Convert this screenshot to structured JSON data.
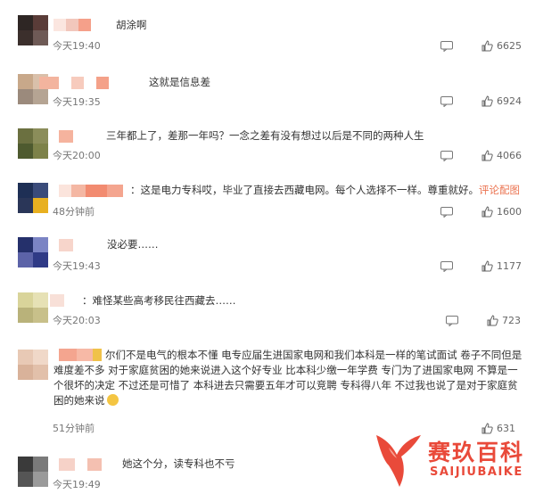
{
  "comments": [
    {
      "text": "胡涂啊",
      "time": "今天19:40",
      "likes": "6625",
      "avatar_colors": [
        "#2e2624",
        "#5a3c38",
        "#3b2f2c",
        "#6e5a56"
      ],
      "name_colors": [
        "#f2c7bc",
        "#f5a08a"
      ]
    },
    {
      "text": "这就是信息差",
      "time": "今天19:35",
      "likes": "6924",
      "avatar_colors": [
        "#c8a88a",
        "#d9c0aa",
        "#9b8a7c",
        "#b5a493"
      ],
      "name_colors": [
        "#f3b49e",
        "#f7cbbd",
        "#f4a189"
      ]
    },
    {
      "text": "三年都上了，差那一年吗？一念之差有没有想过以后是不同的两种人生",
      "time": "今天20:00",
      "likes": "4066",
      "avatar_colors": [
        "#6b7040",
        "#8b8d5a",
        "#4e5a2f",
        "#7d8249"
      ],
      "name_colors": [
        "#f5b39e"
      ]
    },
    {
      "text_prefix": "：这是电力专科哎，毕业了直接去西藏电网。每个人选择不一样。尊重就好。",
      "link": "评论配图",
      "time": "48分钟前",
      "likes": "1600",
      "avatar_colors": [
        "#1e2f55",
        "#3a4b7a",
        "#2a3658",
        "#e8b020"
      ],
      "name_colors": [
        "#f4b7a3",
        "#f28b70",
        "#f4a58f"
      ]
    },
    {
      "text": "没必要……",
      "time": "今天19:43",
      "likes": "1177",
      "avatar_colors": [
        "#25306b",
        "#7b84c4",
        "#5c63a8",
        "#2f3a86"
      ],
      "name_colors": [
        "#f7d5cb"
      ]
    },
    {
      "text": "：难怪某些高考移民往西藏去……",
      "time": "今天20:03",
      "likes": "723",
      "avatar_colors": [
        "#d9d49a",
        "#e6e1b5",
        "#b9b27a",
        "#c8c08a"
      ],
      "name_colors": [
        "#f8e0d8"
      ]
    },
    {
      "text": "尔们不是电气的根本不懂 电专应届生进国家电网和我们本科是一样的笔试面试 卷子不同但是难度差不多 对于家庭贫困的她来说进入这个好专业 比本科少缴一年学费 专门为了进国家电网 不算是一个很坏的决定 不过还是可惜了 本科进去只需要五年才可以竞聘 专科得八年 不过我也说了是对于家庭贫困的她来说",
      "time": "51分钟前",
      "likes": "631",
      "avatar_colors": [
        "#e8c9b5",
        "#f0d8c8",
        "#d9b29a",
        "#e2c0aa"
      ],
      "name_colors": [
        "#f4a58f",
        "#f7b9a6",
        "#f0c24a"
      ]
    },
    {
      "text": "她这个分，读专科也不亏",
      "time": "今天19:49",
      "likes": "",
      "avatar_colors": [
        "#3a3a3a",
        "#7a7a7a",
        "#555555",
        "#9a9a9a"
      ],
      "name_colors": [
        "#f6d2c8",
        "#f4c0b1"
      ]
    }
  ],
  "watermark": {
    "title": "赛玖百科",
    "subtitle": "SAIJIUBAIKE",
    "color": "#e94a3a"
  },
  "icons": {
    "reply": "comment-bubble-icon",
    "like": "thumbs-up-icon",
    "emoji": "crying-face-emoji-icon"
  }
}
